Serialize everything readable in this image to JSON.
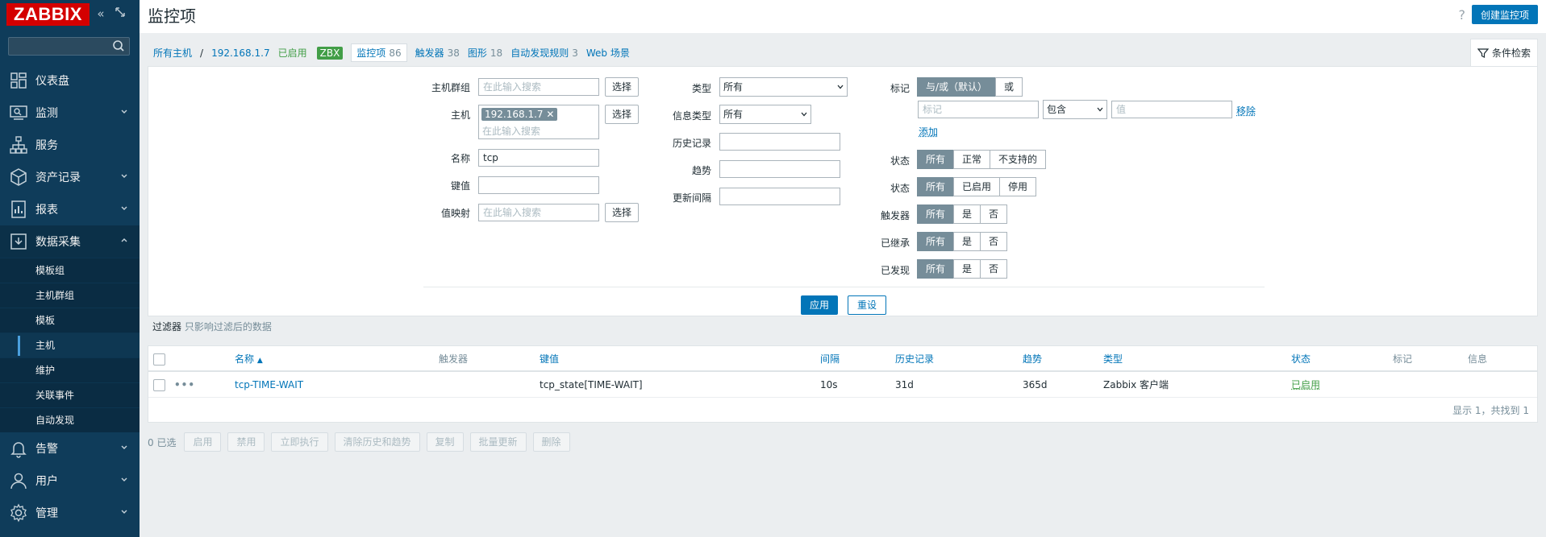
{
  "logo": "ZABBIX",
  "header": {
    "title": "监控项",
    "help": "?",
    "create_button": "创建监控项"
  },
  "sidebar": {
    "search_placeholder": "",
    "items": [
      {
        "label": "仪表盘",
        "icon": "dashboard-icon"
      },
      {
        "label": "监测",
        "icon": "monitoring-icon"
      },
      {
        "label": "服务",
        "icon": "services-icon"
      },
      {
        "label": "资产记录",
        "icon": "inventory-icon"
      },
      {
        "label": "报表",
        "icon": "reports-icon"
      },
      {
        "label": "数据采集",
        "icon": "data-collection-icon"
      }
    ],
    "sub_items": [
      "模板组",
      "主机群组",
      "模板",
      "主机",
      "维护",
      "关联事件",
      "自动发现"
    ],
    "active_sub": "主机",
    "bottom_items": [
      {
        "label": "告警",
        "icon": "bell-icon"
      },
      {
        "label": "用户",
        "icon": "user-icon"
      },
      {
        "label": "管理",
        "icon": "gear-icon"
      }
    ]
  },
  "breadcrumb": {
    "all_hosts": "所有主机",
    "sep": "/",
    "host": "192.168.1.7",
    "enabled": "已启用",
    "zbx": "ZBX",
    "items": "监控项",
    "items_count": "86",
    "triggers": "触发器",
    "triggers_count": "38",
    "graphs": "图形",
    "graphs_count": "18",
    "discovery": "自动发现规则",
    "discovery_count": "3",
    "web": "Web 场景"
  },
  "filter_tab": "条件检索",
  "filter": {
    "host_groups_label": "主机群组",
    "host_groups_placeholder": "在此输入搜索",
    "select": "选择",
    "hosts_label": "主机",
    "host_tag": "192.168.1.7",
    "hosts_placeholder": "在此输入搜索",
    "name_label": "名称",
    "name_value": "tcp",
    "key_label": "键值",
    "key_value": "",
    "valuemap_label": "值映射",
    "valuemap_placeholder": "在此输入搜索",
    "type_label": "类型",
    "type_value": "所有",
    "info_type_label": "信息类型",
    "info_type_value": "所有",
    "history_label": "历史记录",
    "trends_label": "趋势",
    "interval_label": "更新间隔",
    "tags_label": "标记",
    "tags_andor": "与/或（默认）",
    "tags_or": "或",
    "tag_placeholder": "标记",
    "tag_op": "包含",
    "tag_value_placeholder": "值",
    "remove": "移除",
    "add": "添加",
    "state_label": "状态",
    "state_opts": [
      "所有",
      "正常",
      "不支持的"
    ],
    "status_label": "状态",
    "status_opts": [
      "所有",
      "已启用",
      "停用"
    ],
    "triggers_label": "触发器",
    "inherited_label": "已继承",
    "discovered_label": "已发现",
    "yn_opts": [
      "所有",
      "是",
      "否"
    ],
    "apply": "应用",
    "reset": "重设"
  },
  "filter_note": {
    "bold": "过滤器",
    "text": "只影响过滤后的数据"
  },
  "table": {
    "headers": {
      "name": "名称",
      "triggers": "触发器",
      "key": "键值",
      "interval": "间隔",
      "history": "历史记录",
      "trends": "趋势",
      "type": "类型",
      "status": "状态",
      "tags": "标记",
      "info": "信息"
    },
    "rows": [
      {
        "menu": "•••",
        "name": "tcp-TIME-WAIT",
        "triggers": "",
        "key": "tcp_state[TIME-WAIT]",
        "interval": "10s",
        "history": "31d",
        "trends": "365d",
        "type": "Zabbix 客户端",
        "status": "已启用"
      }
    ],
    "footer": "显示 1，共找到 1"
  },
  "actions": {
    "selected": "0 已选",
    "buttons": [
      "启用",
      "禁用",
      "立即执行",
      "清除历史和趋势",
      "复制",
      "批量更新",
      "删除"
    ]
  }
}
